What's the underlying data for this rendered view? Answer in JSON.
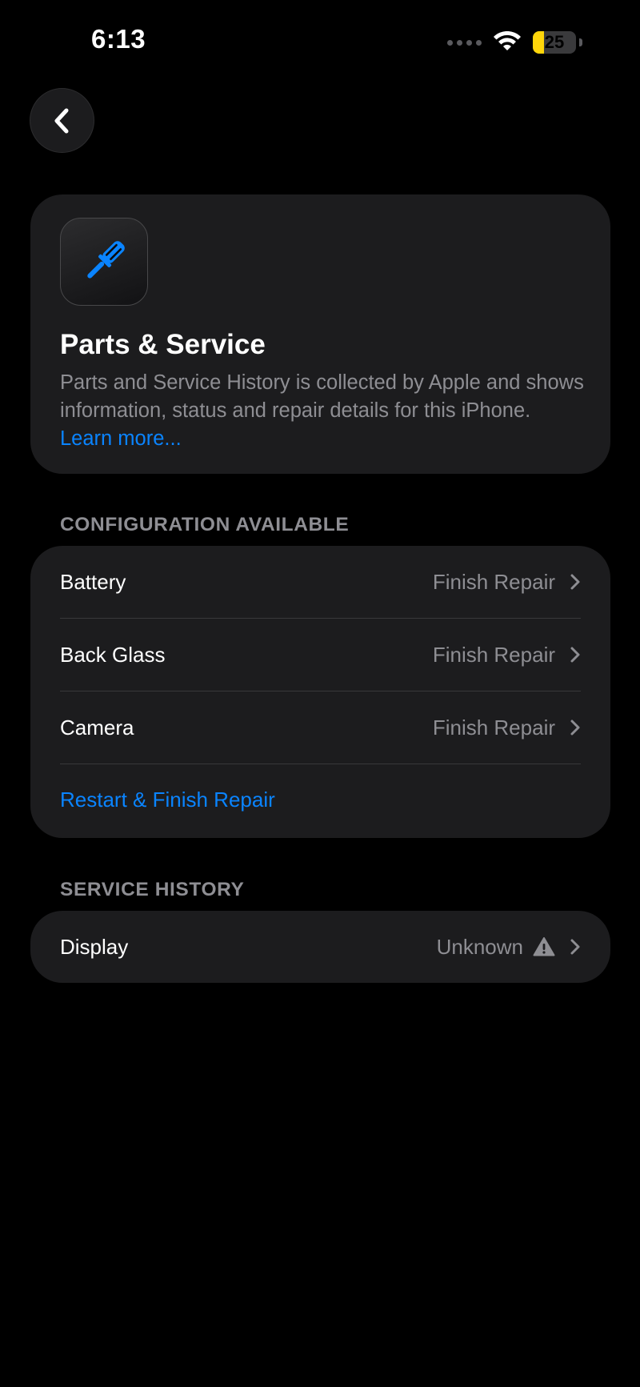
{
  "status_bar": {
    "time": "6:13",
    "battery_level": "25",
    "battery_fraction": 0.25,
    "signal_icon": "signal-dots-icon",
    "wifi_icon": "wifi-icon"
  },
  "nav": {
    "back_icon": "chevron-left-icon"
  },
  "header": {
    "icon": "screwdriver-icon",
    "title": "Parts & Service",
    "description": "Parts and Service History is collected by Apple and shows information, status and repair details for this iPhone. ",
    "learn_more": "Learn more..."
  },
  "configuration": {
    "section_title": "CONFIGURATION AVAILABLE",
    "items": [
      {
        "label": "Battery",
        "value": "Finish Repair"
      },
      {
        "label": "Back Glass",
        "value": "Finish Repair"
      },
      {
        "label": "Camera",
        "value": "Finish Repair"
      }
    ],
    "action": "Restart & Finish Repair"
  },
  "service_history": {
    "section_title": "SERVICE HISTORY",
    "items": [
      {
        "label": "Display",
        "value": "Unknown",
        "status_icon": "warning-icon"
      }
    ]
  },
  "colors": {
    "background": "#000000",
    "card": "#1c1c1e",
    "accent": "#0a84ff",
    "secondary_text": "#8e8e93",
    "battery": "#ffd60a"
  }
}
